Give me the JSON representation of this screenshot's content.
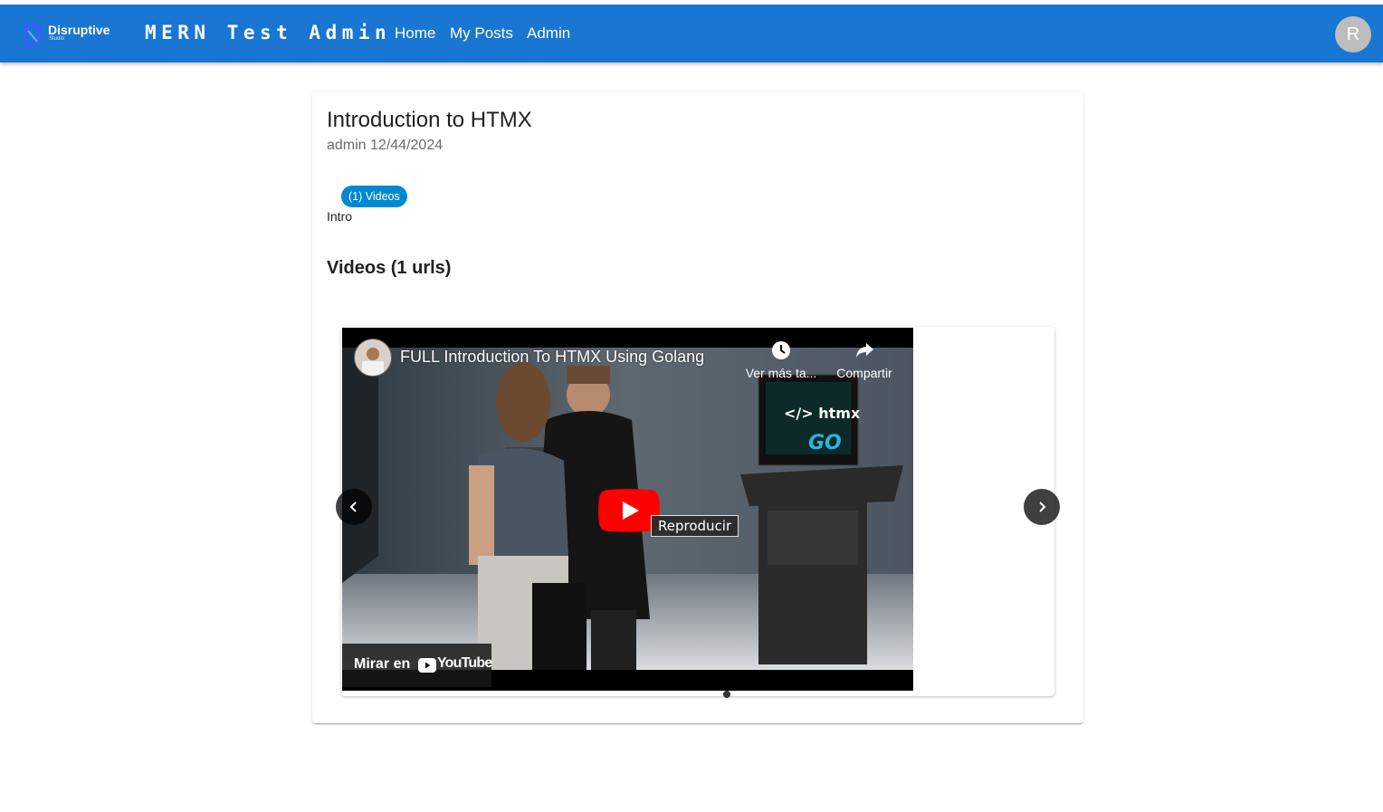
{
  "header": {
    "logo_name": "Disruptive",
    "logo_sub": "Studio",
    "app_title": "MERN Test Admin",
    "nav": [
      "Home",
      "My Posts",
      "Admin"
    ],
    "avatar_initial": "R",
    "brand_color": "#1976d2"
  },
  "post": {
    "title": "Introduction to HTMX",
    "author": "admin",
    "date": "12/44/2024",
    "chip_label": "(1) Videos",
    "chip_caption": "Intro",
    "videos_heading": "Videos (1 urls)"
  },
  "player": {
    "video_title": "FULL Introduction To HTMX Using Golang",
    "watch_later": "Ver más ta...",
    "share": "Compartir",
    "play_tooltip": "Reproducir",
    "watch_on": "Mirar en",
    "youtube_word": "YouTube",
    "thumb_sign_top": "</> htmx",
    "thumb_sign_bottom": "GO"
  },
  "carousel": {
    "prev_icon": "chevron-left-icon",
    "next_icon": "chevron-right-icon",
    "active_index": 0,
    "count": 1
  }
}
